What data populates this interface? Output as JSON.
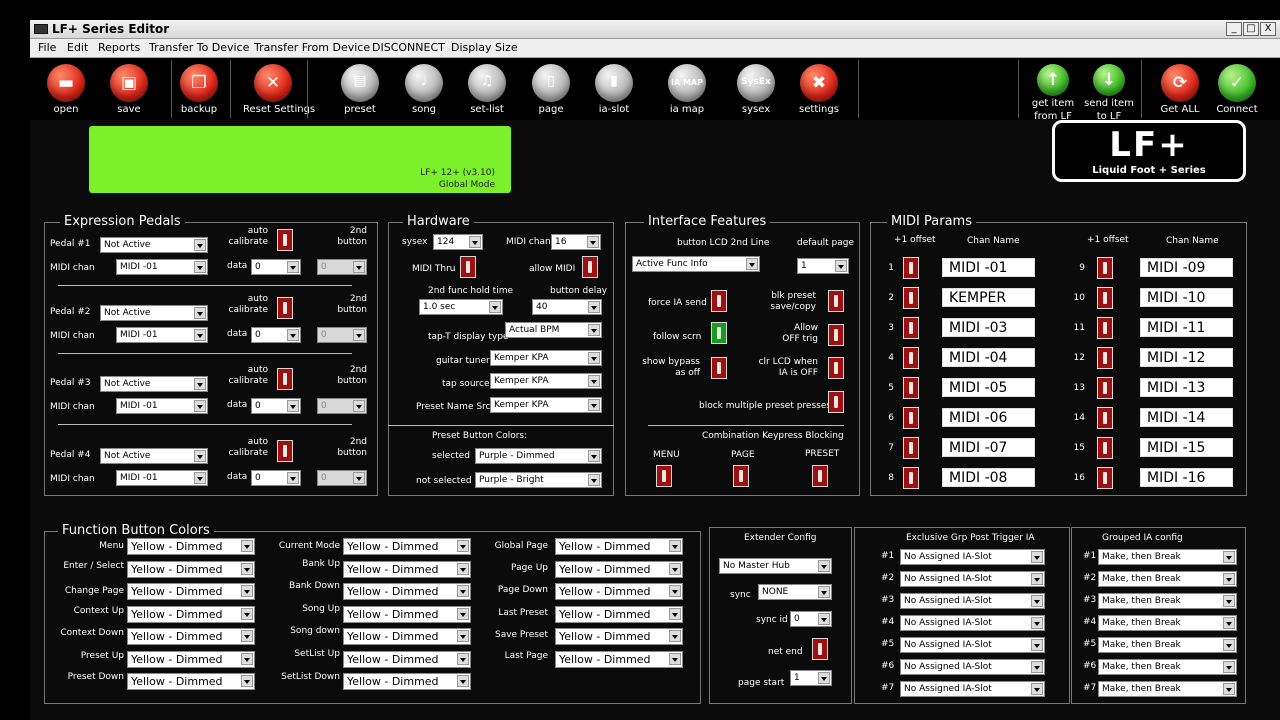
{
  "window": {
    "title": "LF+ Series Editor",
    "min": "_",
    "max": "□",
    "close": "X"
  },
  "menu": [
    "File",
    "Edit",
    "Reports",
    "Transfer To Device",
    "Transfer From Device",
    "DISCONNECT",
    "Display Size"
  ],
  "toolbar": {
    "open": "open",
    "save": "save",
    "backup": "backup",
    "reset": "Reset Settings",
    "preset": "preset",
    "song": "song",
    "setlist": "set-list",
    "page": "page",
    "iaslot": "ia-slot",
    "iamap": "ia map",
    "sysex": "sysex",
    "settings": "settings",
    "get_item_1": "get item",
    "get_item_2": "from LF",
    "send_item_1": "send item",
    "send_item_2": "to LF",
    "get_all": "Get ALL",
    "connect": "Connect",
    "iamap_glyph": "IA MAP",
    "sysex_glyph": "SysEx"
  },
  "lcd": {
    "line1": "LF+ 12+ (v3.10)",
    "line2": "Global Mode"
  },
  "logo": {
    "big": "LF+",
    "small": "Liquid Foot + Series"
  },
  "expression": {
    "title": "Expression Pedals",
    "auto_cal": "auto\ncalibrate",
    "second": "2nd\nbutton",
    "midi_chan_label": "MIDI chan",
    "data_label": "data",
    "pedals": [
      {
        "label": "Pedal #1",
        "mode": "Not Active",
        "midi": "MIDI -01",
        "data": "0",
        "btn": "0"
      },
      {
        "label": "Pedal #2",
        "mode": "Not Active",
        "midi": "MIDI -01",
        "data": "0",
        "btn": "0"
      },
      {
        "label": "Pedal #3",
        "mode": "Not Active",
        "midi": "MIDI -01",
        "data": "0",
        "btn": "0"
      },
      {
        "label": "Pedal #4",
        "mode": "Not Active",
        "midi": "MIDI -01",
        "data": "0",
        "btn": "0"
      }
    ]
  },
  "hardware": {
    "title": "Hardware",
    "sysex_label": "sysex",
    "sysex": "124",
    "midi_chan_label": "MIDI chan",
    "midi_chan": "16",
    "midi_thru": "MIDI Thru",
    "allow_midi": "allow MIDI",
    "hold_label": "2nd func hold time",
    "hold": "1.0 sec",
    "delay_label": "button delay",
    "delay": "40",
    "tapt_label": "tap-T display type",
    "tapt": "Actual BPM",
    "tuner_label": "guitar tuner",
    "tuner": "Kemper KPA",
    "tap_label": "tap source",
    "tap": "Kemper KPA",
    "preset_name_label": "Preset Name Src",
    "preset_name": "Kemper KPA",
    "colors_title": "Preset Button Colors:",
    "selected_label": "selected",
    "selected": "Purple - Dimmed",
    "not_selected_label": "not selected",
    "not_selected": "Purple - Bright"
  },
  "interface": {
    "title": "Interface Features",
    "lcd2_label": "button LCD 2nd Line",
    "lcd2": "Active Func Info",
    "default_page_label": "default page",
    "default_page": "1",
    "force_ia": "force IA send",
    "blk_preset": "blk preset\nsave/copy",
    "follow": "follow scrn",
    "allow_off": "Allow\nOFF trig",
    "show_bypass": "show bypass\nas off",
    "clr_lcd": "clr LCD when\nIA is OFF",
    "block_multi": "block multiple preset presses",
    "combo_title": "Combination Keypress Blocking",
    "menu": "MENU",
    "page": "PAGE",
    "preset": "PRESET"
  },
  "midi_params": {
    "title": "MIDI Params",
    "offset_label": "+1 offset",
    "chan_name_label": "Chan Name",
    "rows": [
      {
        "n": "1",
        "name": "MIDI -01"
      },
      {
        "n": "2",
        "name": "KEMPER"
      },
      {
        "n": "3",
        "name": "MIDI -03"
      },
      {
        "n": "4",
        "name": "MIDI -04"
      },
      {
        "n": "5",
        "name": "MIDI -05"
      },
      {
        "n": "6",
        "name": "MIDI -06"
      },
      {
        "n": "7",
        "name": "MIDI -07"
      },
      {
        "n": "8",
        "name": "MIDI -08"
      },
      {
        "n": "9",
        "name": "MIDI -09"
      },
      {
        "n": "10",
        "name": "MIDI -10"
      },
      {
        "n": "11",
        "name": "MIDI -11"
      },
      {
        "n": "12",
        "name": "MIDI -12"
      },
      {
        "n": "13",
        "name": "MIDI -13"
      },
      {
        "n": "14",
        "name": "MIDI -14"
      },
      {
        "n": "15",
        "name": "MIDI -15"
      },
      {
        "n": "16",
        "name": "MIDI -16"
      }
    ]
  },
  "func_colors": {
    "title": "Function Button Colors",
    "col1": [
      {
        "label": "Menu",
        "value": "Yellow - Dimmed"
      },
      {
        "label": "Enter / Select",
        "value": "Yellow - Dimmed"
      },
      {
        "label": "Change Page",
        "value": "Yellow - Dimmed"
      },
      {
        "label": "Context Up",
        "value": "Yellow - Dimmed"
      },
      {
        "label": "Context Down",
        "value": "Yellow - Dimmed"
      },
      {
        "label": "Preset Up",
        "value": "Yellow - Dimmed"
      },
      {
        "label": "Preset Down",
        "value": "Yellow - Dimmed"
      }
    ],
    "col2": [
      {
        "label": "Current Mode",
        "value": "Yellow - Dimmed"
      },
      {
        "label": "Bank Up",
        "value": "Yellow - Dimmed"
      },
      {
        "label": "Bank Down",
        "value": "Yellow - Dimmed"
      },
      {
        "label": "Song Up",
        "value": "Yellow - Dimmed"
      },
      {
        "label": "Song down",
        "value": "Yellow - Dimmed"
      },
      {
        "label": "SetList Up",
        "value": "Yellow - Dimmed"
      },
      {
        "label": "SetList Down",
        "value": "Yellow - Dimmed"
      }
    ],
    "col3": [
      {
        "label": "Global Page",
        "value": "Yellow - Dimmed"
      },
      {
        "label": "Page Up",
        "value": "Yellow - Dimmed"
      },
      {
        "label": "Page Down",
        "value": "Yellow - Dimmed"
      },
      {
        "label": "Last Preset",
        "value": "Yellow - Dimmed"
      },
      {
        "label": "Save Preset",
        "value": "Yellow - Dimmed"
      },
      {
        "label": "Last Page",
        "value": "Yellow - Dimmed"
      }
    ]
  },
  "extender": {
    "title": "Extender Config",
    "hub": "No Master Hub",
    "sync_label": "sync",
    "sync": "NONE",
    "sync_id_label": "sync id",
    "sync_id": "0",
    "net_end": "net end",
    "page_start_label": "page start",
    "page_start": "1"
  },
  "excl": {
    "title": "Exclusive Grp Post Trigger IA",
    "items": [
      {
        "n": "#1",
        "v": "No Assigned IA-Slot"
      },
      {
        "n": "#2",
        "v": "No Assigned IA-Slot"
      },
      {
        "n": "#3",
        "v": "No Assigned IA-Slot"
      },
      {
        "n": "#4",
        "v": "No Assigned IA-Slot"
      },
      {
        "n": "#5",
        "v": "No Assigned IA-Slot"
      },
      {
        "n": "#6",
        "v": "No Assigned IA-Slot"
      },
      {
        "n": "#7",
        "v": "No Assigned IA-Slot"
      }
    ]
  },
  "grouped": {
    "title": "Grouped IA config",
    "items": [
      {
        "n": "#1",
        "v": "Make, then Break"
      },
      {
        "n": "#2",
        "v": "Make, then Break"
      },
      {
        "n": "#3",
        "v": "Make, then Break"
      },
      {
        "n": "#4",
        "v": "Make, then Break"
      },
      {
        "n": "#5",
        "v": "Make, then Break"
      },
      {
        "n": "#6",
        "v": "Make, then Break"
      },
      {
        "n": "#7",
        "v": "Make, then Break"
      }
    ]
  }
}
